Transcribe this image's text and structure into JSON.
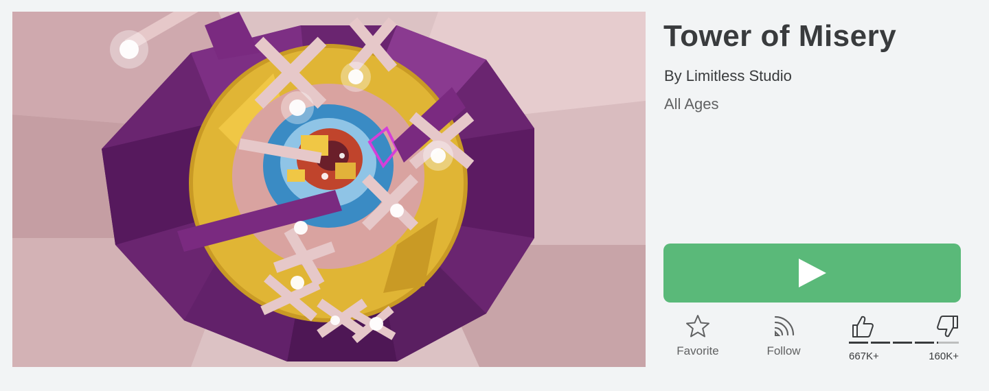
{
  "game": {
    "title": "Tower of Misery",
    "creator_line": "By Limitless Studio",
    "age_rating": "All Ages"
  },
  "thumbnail": {
    "description": "Game thumbnail"
  },
  "play_button": {
    "icon": "play-icon",
    "color": "#5ab979"
  },
  "actions": {
    "favorite": {
      "label": "Favorite",
      "icon": "star-icon"
    },
    "follow": {
      "label": "Follow",
      "icon": "rss-icon"
    }
  },
  "votes": {
    "up_count": "667K+",
    "down_count": "160K+",
    "upvote_fraction": 0.81,
    "up_icon": "thumbs-up-icon",
    "down_icon": "thumbs-down-icon"
  },
  "colors": {
    "background": "#f2f4f5",
    "text_primary": "#393b3d",
    "text_secondary": "#606162",
    "play_green": "#5ab979"
  }
}
